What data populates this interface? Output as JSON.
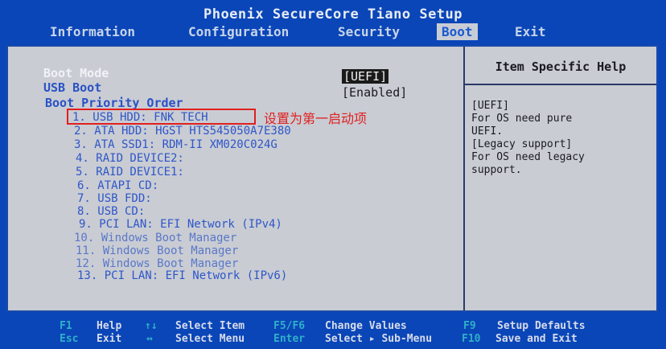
{
  "title": "Phoenix SecureCore Tiano Setup",
  "menu": [
    {
      "label": "Information",
      "active": false
    },
    {
      "label": "Configuration",
      "active": false
    },
    {
      "label": "Security",
      "active": false
    },
    {
      "label": "Boot",
      "active": true
    },
    {
      "label": "Exit",
      "active": false
    }
  ],
  "settings": {
    "boot_mode_label": "Boot Mode",
    "boot_mode_value": "[UEFI]",
    "usb_boot_label": "USB Boot",
    "usb_boot_value": "[Enabled]",
    "priority_label": "Boot Priority Order"
  },
  "boot_order": [
    "1. USB HDD: FNK TECH",
    "2. ATA HDD: HGST HTS545050A7E380",
    "3. ATA SSD1: RDM-II XM020C024G",
    "4. RAID DEVICE2:",
    "5. RAID DEVICE1:",
    "6. ATAPI CD:",
    "7. USB FDD:",
    "8. USB CD:",
    "9. PCI LAN: EFI Network (IPv4)",
    "10. Windows Boot Manager",
    "11. Windows Boot Manager",
    "12. Windows Boot Manager",
    "13. PCI LAN: EFI Network (IPv6)"
  ],
  "annotation": "设置为第一启动项",
  "help": {
    "title": "Item Specific Help",
    "lines": [
      "[UEFI]",
      "For OS need pure",
      "UEFI.",
      "[Legacy support]",
      "For OS need legacy",
      "support."
    ]
  },
  "footer": {
    "f1_key": "F1",
    "f1_desc": "Help",
    "esc_key": "Esc",
    "esc_desc": "Exit",
    "updown_key": "↑↓",
    "updown_desc": "Select Item",
    "lr_key": "↔",
    "lr_desc": "Select Menu",
    "f5f6_key": "F5/F6",
    "f5f6_desc": "Change Values",
    "enter_key": "Enter",
    "enter_desc": "Select ▸ Sub-Menu",
    "f9_key": "F9",
    "f9_desc": "Setup Defaults",
    "f10_key": "F10",
    "f10_desc": "Save and Exit"
  }
}
